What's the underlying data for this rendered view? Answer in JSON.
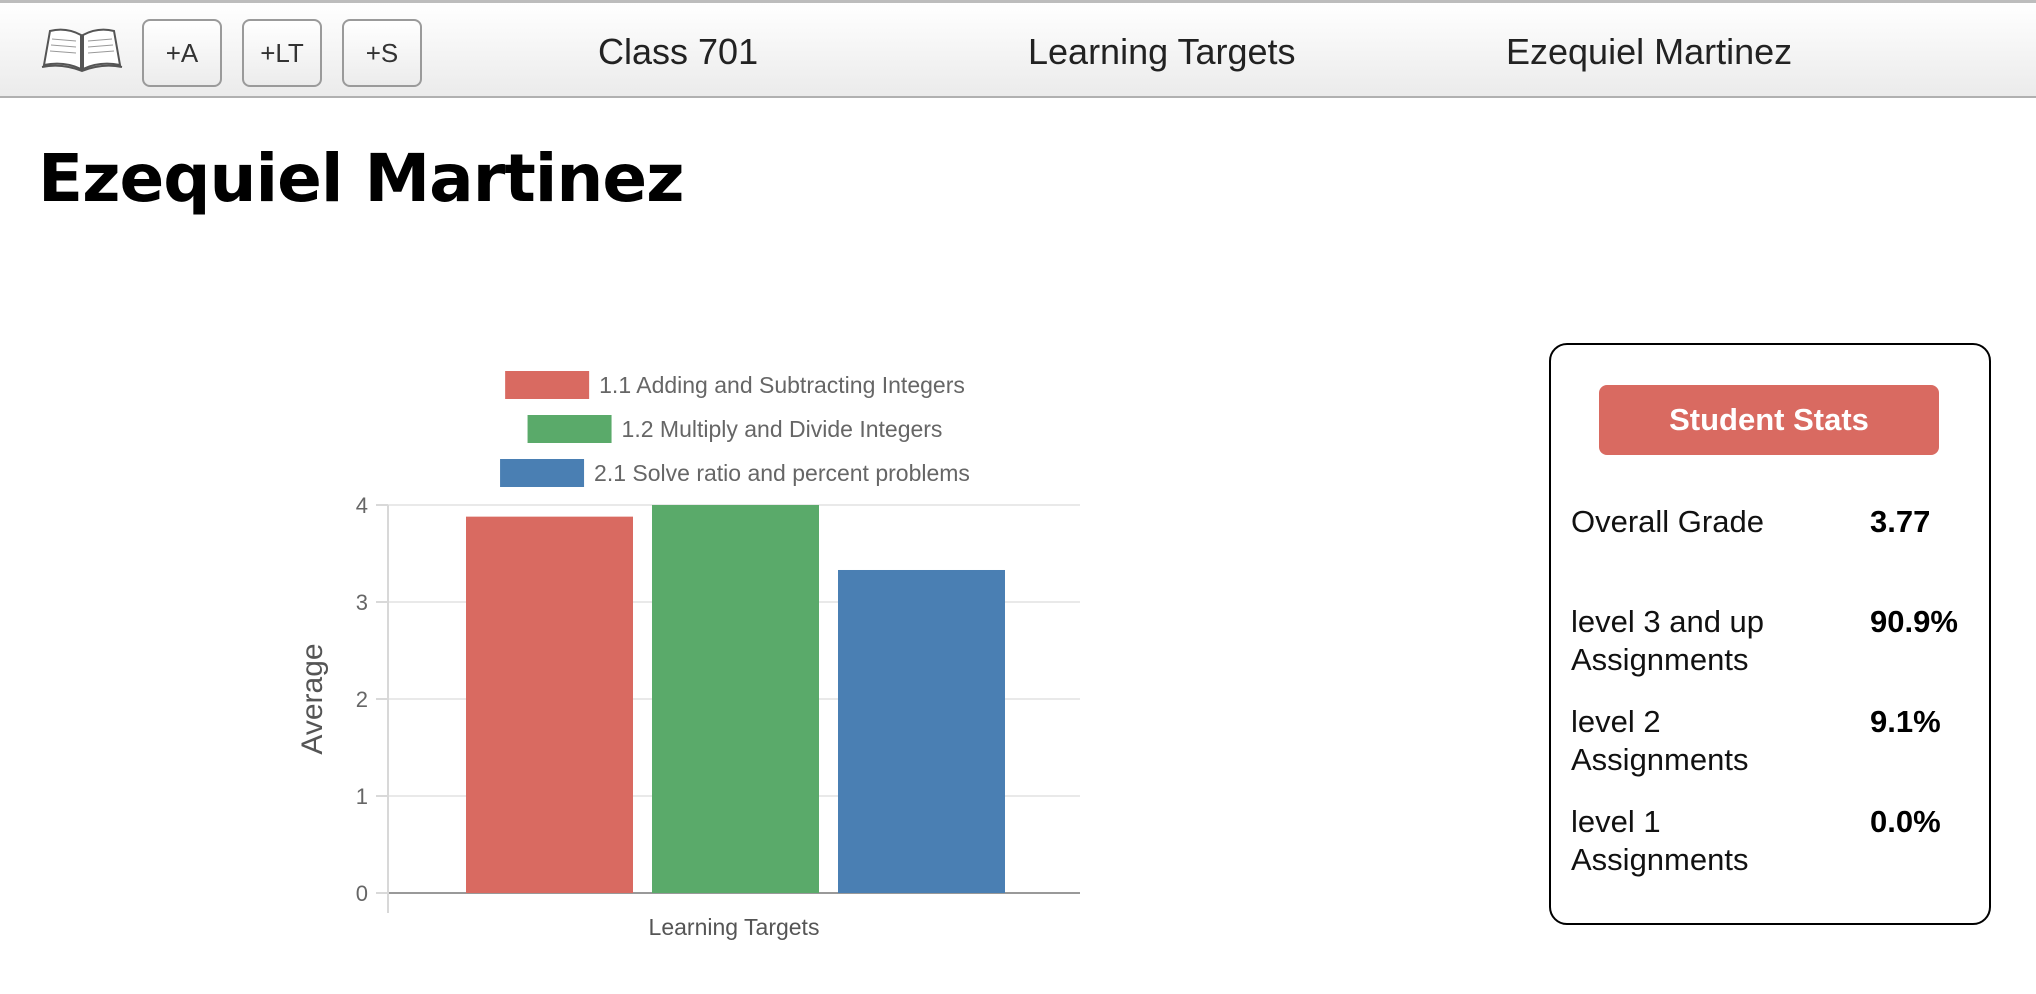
{
  "topbar": {
    "logo_icon": "open-book-icon",
    "buttons": {
      "add_assignment": "+A",
      "add_learning_target": "+LT",
      "add_student": "+S"
    },
    "nav": {
      "class": "Class 701",
      "learning_targets": "Learning Targets",
      "student": "Ezequiel Martinez"
    }
  },
  "page": {
    "title": "Ezequiel Martinez"
  },
  "chart_data": {
    "type": "bar",
    "xlabel": "Learning Targets",
    "ylabel": "Average",
    "ylim": [
      0,
      4
    ],
    "yticks": [
      "0",
      "1",
      "2",
      "3",
      "4"
    ],
    "grid": true,
    "legend_position": "top",
    "series": [
      {
        "name": "1.1 Adding and Subtracting Integers",
        "value": 3.88,
        "color": "#d96a61"
      },
      {
        "name": "1.2 Multiply and Divide Integers",
        "value": 4.0,
        "color": "#5aaa6a"
      },
      {
        "name": "2.1 Solve ratio and percent problems",
        "value": 3.33,
        "color": "#4a7fb3"
      }
    ]
  },
  "stats": {
    "header": "Student Stats",
    "header_color": "#d96a61",
    "rows": [
      {
        "label": "Overall Grade",
        "value": "3.77"
      },
      {
        "label": "level 3 and up Assignments",
        "value": "90.9%"
      },
      {
        "label": "level 2 Assignments",
        "value": "9.1%"
      },
      {
        "label": "level 1 Assignments",
        "value": "0.0%"
      }
    ]
  }
}
